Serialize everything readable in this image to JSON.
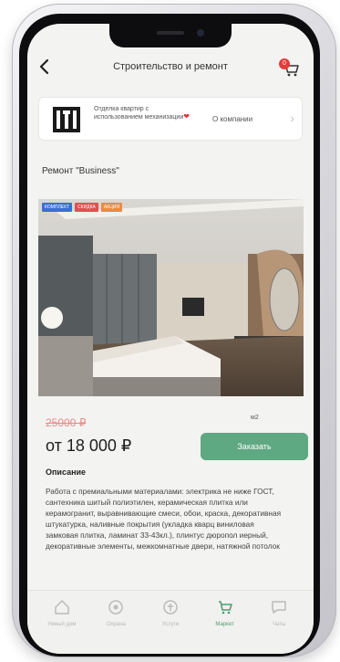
{
  "header": {
    "title": "Строительство и ремонт",
    "back_icon": "chevron-left-icon",
    "cart_icon": "cart-icon",
    "cart_count": "0"
  },
  "company": {
    "description": "Отделка квартир с использованием механизации",
    "link_label": "О компании"
  },
  "product": {
    "title": "Ремонт \"Business\"",
    "tags": [
      {
        "label": "КОМПЛЕКТ",
        "color": "#3b6fd6"
      },
      {
        "label": "СКИДКА",
        "color": "#e05050"
      },
      {
        "label": "АКЦИЯ",
        "color": "#f08a3c"
      }
    ],
    "old_price": "25000 ₽",
    "unit": "м2",
    "price": "от 18 000 ₽",
    "order_label": "Заказать",
    "description_heading": "Описание",
    "description": "Работа с премиальными материалами: электрика не ниже ГОСТ, сантехника шитый полиэтилен, керамическая плитка или керамогранит, выравнивающие смеси, обои, краска, декоративная штукатурка, наливные покрытия (укладка кварц виниловая замковая плитка, ламинат 33-43кл.), плинтус дюропол иерный, декоративные элементы, межкомнатные двери, натяжной потолок"
  },
  "bottom_nav": [
    {
      "label": "Умный дом",
      "icon": "home-icon",
      "active": false
    },
    {
      "label": "Охрана",
      "icon": "shield-icon",
      "active": false
    },
    {
      "label": "Услуги",
      "icon": "services-icon",
      "active": false
    },
    {
      "label": "Маркет",
      "icon": "market-icon",
      "active": true
    },
    {
      "label": "Чаты",
      "icon": "chat-icon",
      "active": false
    }
  ],
  "colors": {
    "accent": "#5ea882",
    "active_nav": "#4e9d73",
    "badge": "#e53b3b"
  }
}
